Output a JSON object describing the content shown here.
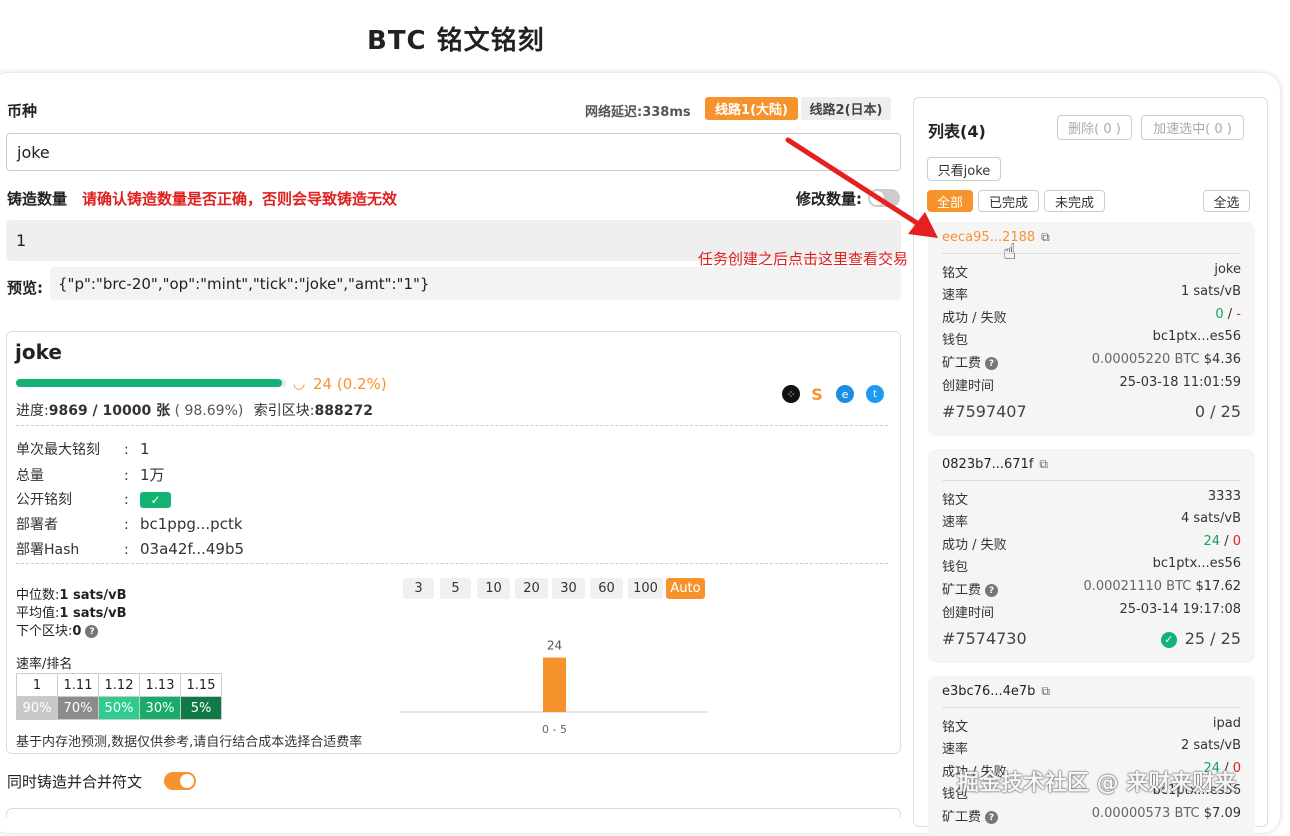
{
  "page": {
    "title": "BTC 铭文铭刻"
  },
  "form": {
    "coin_label": "币种",
    "latency": "网络延迟:338ms",
    "line1": "线路1(大陆)",
    "line2": "线路2(日本)",
    "coin_value": "joke",
    "mint_qty_label": "铸造数量",
    "mint_qty_warning": "请确认铸造数量是否正确，否则会导致铸造无效",
    "modify_qty_label": "修改数量:",
    "mint_qty_value": "1",
    "preview_label": "预览:",
    "preview_value": "{\"p\":\"brc-20\",\"op\":\"mint\",\"tick\":\"joke\",\"amt\":\"1\"}",
    "merge_label": "同时铸造并合并符文"
  },
  "token": {
    "name": "joke",
    "progress_fraction": 0.986,
    "pending_text": "24 (0.2%)",
    "progress_label": "进度:",
    "progress_value": "9869 / 10000 张",
    "progress_pct": "( 98.69%)",
    "index_label": "索引区块:",
    "index_value": "888272",
    "details": [
      {
        "k": "单次最大铭刻",
        "v": "1"
      },
      {
        "k": "总量",
        "v": "1万"
      },
      {
        "k": "公开铭刻",
        "v": "✓"
      },
      {
        "k": "部署者",
        "v": "bc1ppg...pctk"
      },
      {
        "k": "部署Hash",
        "v": "03a42f...49b5"
      }
    ],
    "median_label": "中位数:",
    "median_value": "1 sats/vB",
    "avg_label": "平均值:",
    "avg_value": "1 sats/vB",
    "next_label": "下个区块:",
    "next_value": "0",
    "rate_rank_label": "速率/排名",
    "rate_values": [
      "1",
      "1.11",
      "1.12",
      "1.13",
      "1.15"
    ],
    "rank_values": [
      "90%",
      "70%",
      "50%",
      "30%",
      "5%"
    ],
    "rank_colors": [
      "#c8c8c8",
      "#8c8c8c",
      "#2ecc8f",
      "#1aaa6a",
      "#0f7a45"
    ],
    "note": "基于内存池预测,数据仅供参考,请自行结合成本选择合适费率",
    "fee_chips": [
      "3",
      "5",
      "10",
      "20",
      "30",
      "60",
      "100",
      "Auto"
    ],
    "icons": [
      "share-icon",
      "swap-icon",
      "explorer-icon",
      "twitter-icon"
    ]
  },
  "chart_data": {
    "type": "bar",
    "categories": [
      "0 - 5"
    ],
    "values": [
      24
    ],
    "ylim": [
      0,
      30
    ]
  },
  "list": {
    "title": "列表(4)",
    "delete_btn": "删除( 0 )",
    "accelerate_btn": "加速选中( 0 )",
    "only_view": "只看joke",
    "filters": [
      "全部",
      "已完成",
      "未完成"
    ],
    "select_all": "全选",
    "annotation": "任务创建之后点击这里查看交易",
    "tasks": [
      {
        "hash": "eeca95...2188",
        "rows": [
          {
            "k": "铭文",
            "v": "joke"
          },
          {
            "k": "速率",
            "v": "1 sats/vB"
          },
          {
            "k": "成功 / 失败",
            "ok": "0",
            "fail": "-"
          },
          {
            "k": "钱包",
            "v": "bc1ptx...es56"
          },
          {
            "k": "矿工费",
            "v": "0.00005220 BTC",
            "v2": "$4.36"
          },
          {
            "k": "创建时间",
            "v": "25-03-18 11:01:59"
          }
        ],
        "id": "#7597407",
        "count": "0 / 25"
      },
      {
        "hash": "0823b7...671f",
        "rows": [
          {
            "k": "铭文",
            "v": "3333"
          },
          {
            "k": "速率",
            "v": "4 sats/vB"
          },
          {
            "k": "成功 / 失败",
            "ok": "24",
            "fail": "0"
          },
          {
            "k": "钱包",
            "v": "bc1ptx...es56"
          },
          {
            "k": "矿工费",
            "v": "0.00021110 BTC",
            "v2": "$17.62"
          },
          {
            "k": "创建时间",
            "v": "25-03-14 19:17:08"
          }
        ],
        "id": "#7574730",
        "count": "25 / 25"
      },
      {
        "hash": "e3bc76...4e7b",
        "rows": [
          {
            "k": "铭文",
            "v": "ipad"
          },
          {
            "k": "速率",
            "v": "2 sats/vB"
          },
          {
            "k": "成功 / 失败",
            "ok": "24",
            "fail": "0"
          },
          {
            "k": "钱包",
            "v": "bc1ptx...es56"
          },
          {
            "k": "矿工费",
            "v": "0.00000573 BTC",
            "v2": "$7.09"
          }
        ]
      }
    ]
  },
  "watermark": "掘金技术社区 @ 来财来财来",
  "colors": {
    "orange": "#f7932d",
    "green": "#1aaa6a",
    "red": "#e02020"
  }
}
